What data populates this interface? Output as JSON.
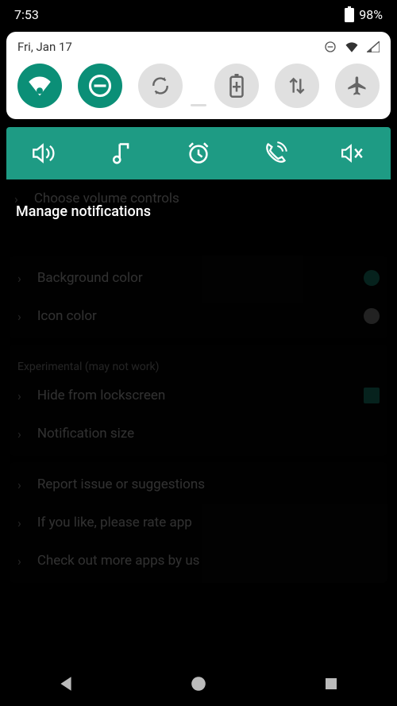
{
  "status": {
    "time": "7:53",
    "battery": "98%"
  },
  "qs": {
    "date": "Fri, Jan 17",
    "tiles": {
      "wifi": "wifi-icon",
      "dnd": "do-not-disturb-icon",
      "sync": "auto-rotate-icon",
      "battery": "battery-saver-icon",
      "data": "mobile-data-icon",
      "airplane": "airplane-icon"
    }
  },
  "media": {
    "volume": "volume-icon",
    "music": "music-note-icon",
    "alarm": "alarm-icon",
    "call": "call-icon",
    "mute": "mute-icon"
  },
  "settings": {
    "choose": "Choose volume controls",
    "manage_title": "Manage notifications",
    "bgcolor": "Background color",
    "iconcolor": "Icon color",
    "experimental_label": "Experimental (may not work)",
    "hide_lock": "Hide from lockscreen",
    "notif_size": "Notification size",
    "report": "Report issue or suggestions",
    "rate": "If you like, please rate app",
    "more_apps": "Check out more apps by us"
  },
  "colors": {
    "accent": "#1e9b84"
  }
}
